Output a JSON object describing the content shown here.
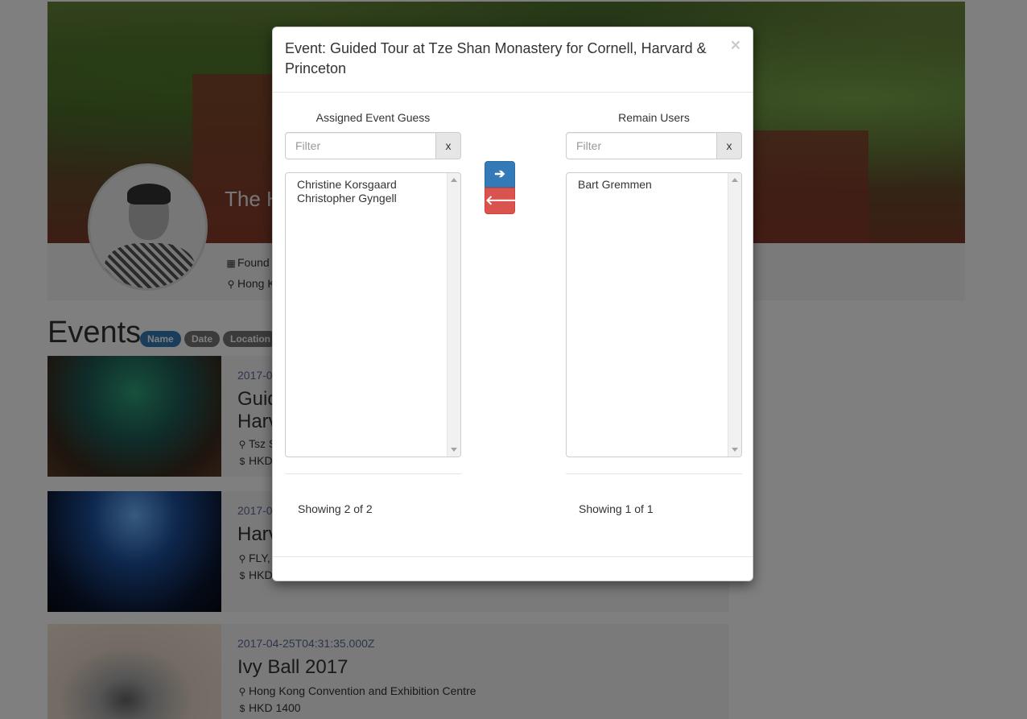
{
  "profile": {
    "title_partial": "The H",
    "founded_partial": "Found",
    "location_partial": "Hong K"
  },
  "events_section": {
    "heading": "Events",
    "sort_pills": [
      "Name",
      "Date",
      "Location"
    ],
    "active_pill": "Name"
  },
  "events": [
    {
      "date": "2017-0",
      "name_lines": [
        "Guid",
        "Harv"
      ],
      "location": "Tsz S",
      "price": "HKD"
    },
    {
      "date": "2017-0",
      "name_lines": [
        "Harv"
      ],
      "location": "FLY,",
      "price": "HKD"
    },
    {
      "date": "2017-04-25T04:31:35.000Z",
      "name_lines": [
        "Ivy Ball 2017"
      ],
      "location": "Hong Kong Convention and Exhibition Centre",
      "price": "HKD 1400"
    }
  ],
  "modal": {
    "title": "Event: Guided Tour at Tze Shan Monastery for Cornell, Harvard & Princeton",
    "close_symbol": "×",
    "left": {
      "title": "Assigned Event Guess",
      "filter_placeholder": "Filter",
      "filter_value": "",
      "clear_label": "x",
      "items": [
        "Christine Korsgaard",
        "Christopher Gyngell"
      ],
      "showing": "Showing 2 of 2"
    },
    "right": {
      "title": "Remain Users",
      "filter_placeholder": "Filter",
      "filter_value": "",
      "clear_label": "x",
      "items": [
        "Bart Gremmen"
      ],
      "showing": "Showing 1 of 1"
    },
    "move_right_symbol": "➔",
    "move_left_symbol": "🡐"
  },
  "icons": {
    "building": "building-icon",
    "map_marker": "map-marker-icon",
    "dollar": "dollar-icon",
    "arrow_right": "arrow-right-icon",
    "arrow_left": "arrow-left-icon"
  },
  "colors": {
    "primary": "#337ab7",
    "danger": "#d9534f",
    "backdrop": "rgba(0,0,0,0.5)"
  }
}
